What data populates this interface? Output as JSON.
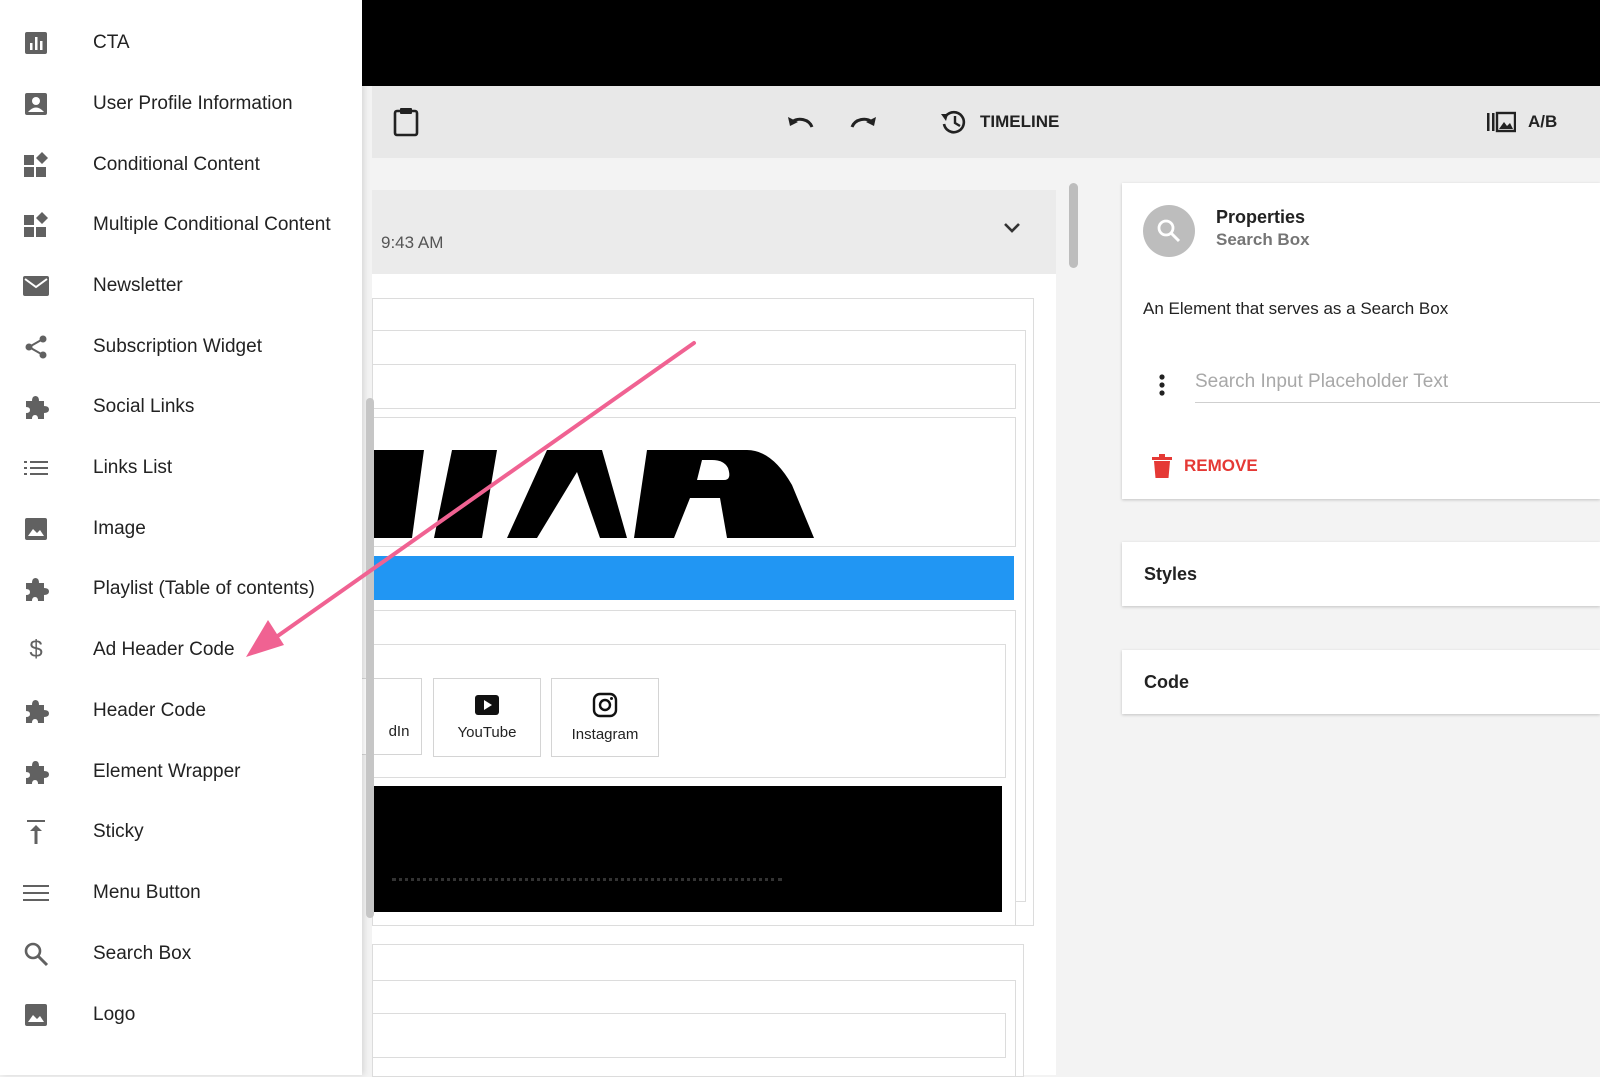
{
  "sidebar": {
    "items": [
      {
        "label": "CTA",
        "icon": "bar-chart-icon"
      },
      {
        "label": "User Profile Information",
        "icon": "account-box-icon"
      },
      {
        "label": "Conditional Content",
        "icon": "widgets-icon"
      },
      {
        "label": "Multiple Conditional Content",
        "icon": "widgets-icon"
      },
      {
        "label": "Newsletter",
        "icon": "mail-icon"
      },
      {
        "label": "Subscription Widget",
        "icon": "share-icon"
      },
      {
        "label": "Social Links",
        "icon": "puzzle-icon"
      },
      {
        "label": "Links List",
        "icon": "list-icon"
      },
      {
        "label": "Image",
        "icon": "image-icon"
      },
      {
        "label": "Playlist (Table of contents)",
        "icon": "puzzle-icon"
      },
      {
        "label": "Ad Header Code",
        "icon": "dollar-icon"
      },
      {
        "label": "Header Code",
        "icon": "puzzle-icon"
      },
      {
        "label": "Element Wrapper",
        "icon": "puzzle-icon"
      },
      {
        "label": "Sticky",
        "icon": "vertical-align-top-icon"
      },
      {
        "label": "Menu Button",
        "icon": "menu-icon"
      },
      {
        "label": "Search Box",
        "icon": "search-icon"
      },
      {
        "label": "Logo",
        "icon": "image-icon"
      }
    ]
  },
  "toolbar": {
    "timeline_label": "TIMELINE",
    "ab_label": "A/B"
  },
  "canvas": {
    "time_text": "9:43 AM",
    "social_partial": "dIn",
    "social_youtube": "YouTube",
    "social_instagram": "Instagram"
  },
  "properties": {
    "title": "Properties",
    "subtitle": "Search Box",
    "description": "An Element that serves as a Search Box",
    "input_placeholder": "Search Input Placeholder Text",
    "remove_label": "REMOVE"
  },
  "panels": {
    "styles_label": "Styles",
    "code_label": "Code"
  },
  "colors": {
    "accent_blue": "#2196f3",
    "remove_red": "#e53935",
    "annotation_pink": "#f06292"
  }
}
